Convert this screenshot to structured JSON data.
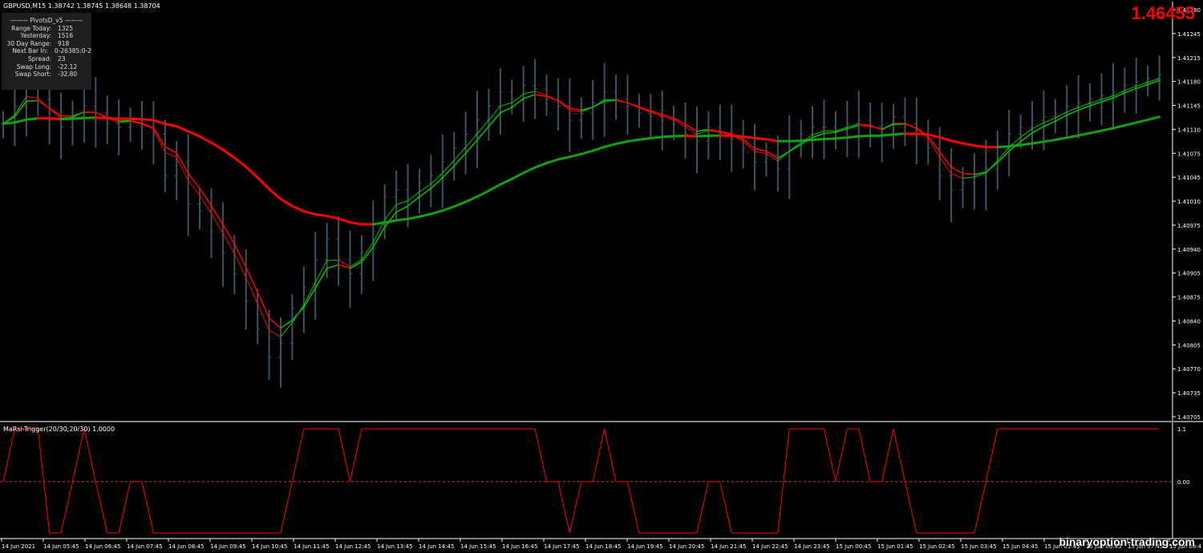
{
  "header": {
    "symbol_line": "GBPUSD,M15  1.38742 1.38745 1.38648 1.38704",
    "big_price": "1.46455",
    "big_price_color": "#ff0000"
  },
  "pivots": {
    "title": "PivotsD_v5",
    "rows": [
      {
        "label": "Range  Today:",
        "value": "1325"
      },
      {
        "label": "Yesterday:",
        "value": "1516"
      },
      {
        "label": "30 Day Range:",
        "value": "918"
      },
      {
        "label": "Next Bar In:",
        "value": "0-26385:0-2"
      },
      {
        "label": "Spread:",
        "value": "23"
      },
      {
        "label": "Swap  Long:",
        "value": "-22.12"
      },
      {
        "label": "Swap  Short:",
        "value": "-32.80"
      }
    ]
  },
  "subwindow": {
    "title": "MaRsi-Trigger(20/30;20/30) 1.0000",
    "levels": [
      "1.1",
      "0.00"
    ]
  },
  "watermark": "binaryoption-trading.com",
  "colors": {
    "bear": "#ff0000",
    "bull": "#00c000",
    "candle": "#3a5560",
    "slow_bull": "#10a010"
  },
  "chart_data": {
    "type": "candlestick",
    "price_axis": [
      "1.41280",
      "1.41245",
      "1.41215",
      "1.41180",
      "1.41145",
      "1.41110",
      "1.41075",
      "1.41045",
      "1.41010",
      "1.40975",
      "1.40940",
      "1.40905",
      "1.40875",
      "1.40840",
      "1.40805",
      "1.40770",
      "1.40735",
      "1.40705"
    ],
    "time_axis": [
      "14 Jun 2021",
      "14 Jun 05:45",
      "14 Jun 06:45",
      "14 Jun 07:45",
      "14 Jun 08:45",
      "14 Jun 09:45",
      "14 Jun 10:45",
      "14 Jun 11:45",
      "14 Jun 12:45",
      "14 Jun 13:45",
      "14 Jun 14:45",
      "14 Jun 15:45",
      "14 Jun 16:45",
      "14 Jun 17:45",
      "14 Jun 18:45",
      "14 Jun 19:45",
      "14 Jun 20:45",
      "14 Jun 21:45",
      "14 Jun 22:45",
      "14 Jun 23:45",
      "15 Jun 00:45",
      "15 Jun 01:45",
      "15 Jun 02:45",
      "15 Jun 03:45",
      "15 Jun 04:45",
      "15 Jun 05:45",
      "15 Jun 06:45",
      "15 Jun 07:45",
      "15 Jun 08:4"
    ],
    "closes": [
      1.41115,
      1.4114,
      1.4118,
      1.4115,
      1.4112,
      1.4111,
      1.41125,
      1.4114,
      1.4113,
      1.41115,
      1.4111,
      1.4112,
      1.4111,
      1.411,
      1.4104,
      1.4106,
      1.41,
      1.4099,
      1.4096,
      1.4093,
      1.409,
      1.4086,
      1.4082,
      1.4078,
      1.408,
      1.4085,
      1.4088,
      1.4092,
      1.4095,
      1.4092,
      1.409,
      1.4093,
      1.4097,
      1.4101,
      1.4102,
      1.4101,
      1.4103,
      1.4104,
      1.4106,
      1.4108,
      1.411,
      1.4112,
      1.4114,
      1.4116,
      1.4115,
      1.4117,
      1.41165,
      1.4115,
      1.4114,
      1.4112,
      1.4113,
      1.41145,
      1.4116,
      1.4115,
      1.4114,
      1.4113,
      1.41125,
      1.4112,
      1.41115,
      1.411,
      1.4109,
      1.4111,
      1.411,
      1.41095,
      1.4108,
      1.4106,
      1.4107,
      1.4105,
      1.4109,
      1.411,
      1.4111,
      1.4111,
      1.41105,
      1.41115,
      1.4112,
      1.4111,
      1.411,
      1.41125,
      1.41115,
      1.411,
      1.4108,
      1.4104,
      1.4102,
      1.4103,
      1.4104,
      1.4105,
      1.4108,
      1.411,
      1.4111,
      1.4112,
      1.41125,
      1.4113,
      1.4114,
      1.41145,
      1.4115,
      1.41155,
      1.4116,
      1.4117,
      1.41175,
      1.4118,
      1.41185
    ]
  }
}
